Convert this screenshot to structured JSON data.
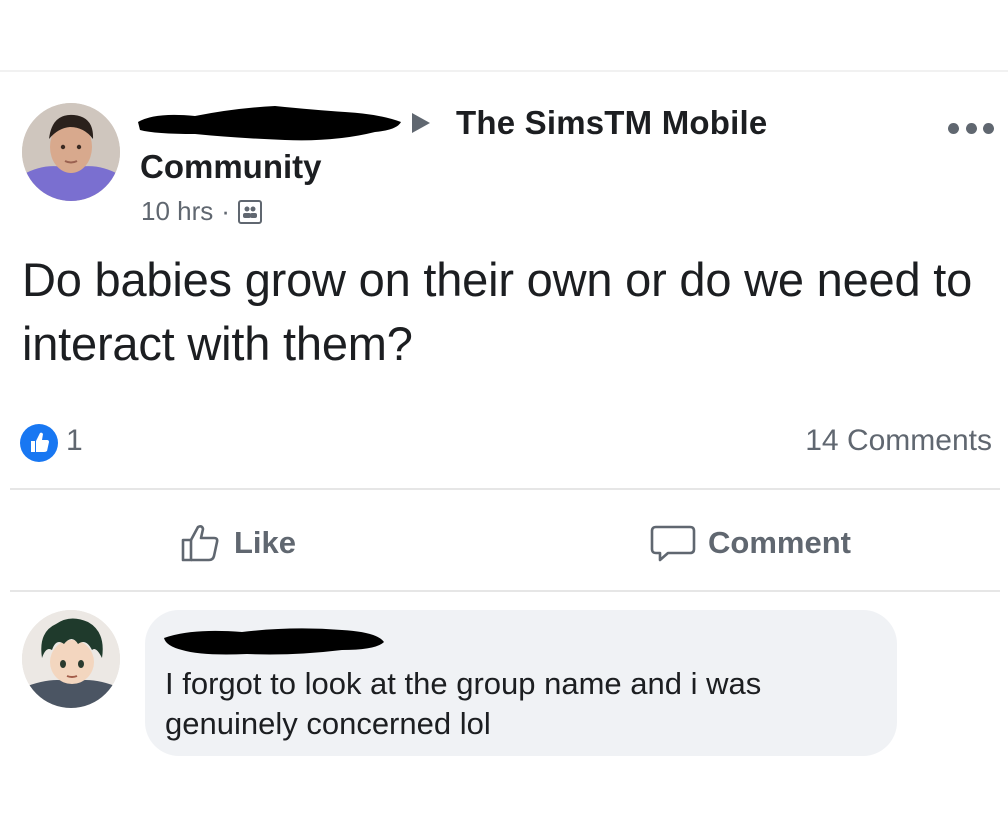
{
  "post": {
    "group_name": "The SimsTM Mobile",
    "group_name_line2": "Community",
    "timestamp": "10 hrs",
    "separator": "·",
    "text": "Do babies grow on their own or do we need to interact with them?",
    "like_count": "1",
    "comment_count": "14 Comments"
  },
  "actions": {
    "like_label": "Like",
    "comment_label": "Comment"
  },
  "comment": {
    "text": "I forgot to look at the group name and i was genuinely concerned lol"
  },
  "colors": {
    "text": "#1c1e21",
    "secondary": "#606770",
    "like_blue": "#1877f2",
    "bubble": "#f0f2f5"
  },
  "icons": {
    "share_arrow": "play-triangle-icon",
    "privacy": "group-members-icon",
    "more": "more-options-icon",
    "reaction": "like-reaction-icon",
    "like": "thumbs-up-icon",
    "comment": "speech-bubble-icon"
  }
}
